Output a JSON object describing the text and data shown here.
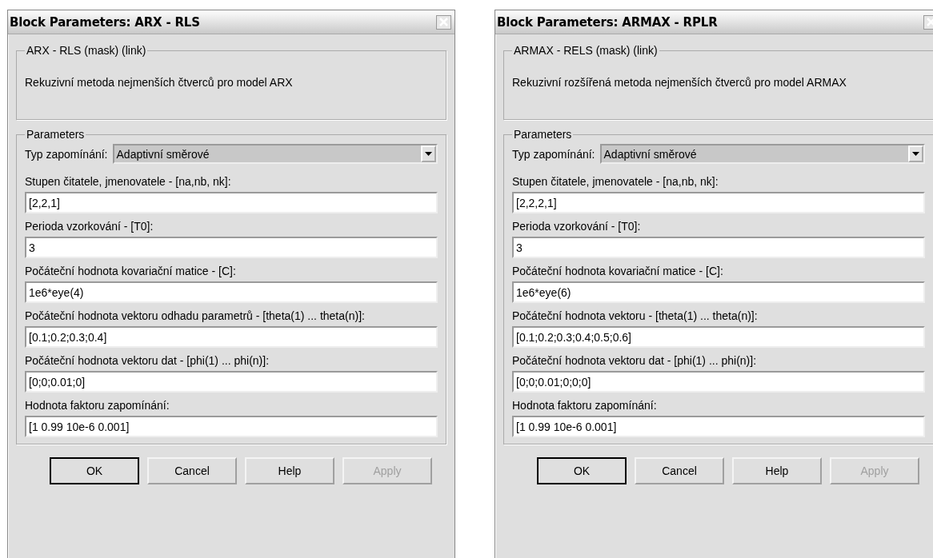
{
  "dialogs": [
    {
      "title": "Block Parameters: ARX - RLS",
      "mask_group": {
        "title": "ARX - RLS (mask) (link)",
        "description": "Rekuzivní metoda nejmenších čtverců pro model ARX"
      },
      "parameters_group": {
        "title": "Parameters",
        "combo": {
          "label": "Typ zapomínání:",
          "value": "Adaptivní směrové"
        },
        "fields": [
          {
            "label": "Stupen čitatele, jmenovatele - [na,nb, nk]:",
            "value": "[2,2,1]"
          },
          {
            "label": "Perioda vzorkování - [T0]:",
            "value": "3"
          },
          {
            "label": "Počáteční hodnota kovariační matice - [C]:",
            "value": "1e6*eye(4)"
          },
          {
            "label": "Počáteční hodnota vektoru odhadu parametrů - [theta(1) ... theta(n)]:",
            "value": "[0.1;0.2;0.3;0.4]"
          },
          {
            "label": "Počáteční hodnota vektoru dat - [phi(1) ... phi(n)]:",
            "value": "[0;0;0.01;0]"
          },
          {
            "label": "Hodnota faktoru zapomínání:",
            "value": "[1 0.99 10e-6 0.001]"
          }
        ]
      },
      "buttons": [
        {
          "label": "OK",
          "default": true,
          "disabled": false
        },
        {
          "label": "Cancel",
          "default": false,
          "disabled": false
        },
        {
          "label": "Help",
          "default": false,
          "disabled": false
        },
        {
          "label": "Apply",
          "default": false,
          "disabled": true
        }
      ]
    },
    {
      "title": "Block Parameters: ARMAX - RPLR",
      "mask_group": {
        "title": "ARMAX - RELS (mask) (link)",
        "description": "Rekuzivní rozšířená metoda nejmenších čtverců pro model ARMAX"
      },
      "parameters_group": {
        "title": "Parameters",
        "combo": {
          "label": "Typ zapomínání:",
          "value": "Adaptivní směrové"
        },
        "fields": [
          {
            "label": "Stupen čitatele, jmenovatele - [na,nb, nk]:",
            "value": "[2,2,2,1]"
          },
          {
            "label": "Perioda vzorkování - [T0]:",
            "value": "3"
          },
          {
            "label": "Počáteční hodnota kovariační matice - [C]:",
            "value": "1e6*eye(6)"
          },
          {
            "label": "Počáteční hodnota vektoru - [theta(1) ... theta(n)]:",
            "value": "[0.1;0.2;0.3;0.4;0.5;0.6]"
          },
          {
            "label": "Počáteční hodnota vektoru dat - [phi(1) ... phi(n)]:",
            "value": "[0;0;0.01;0;0;0]"
          },
          {
            "label": "Hodnota faktoru zapomínání:",
            "value": "[1 0.99 10e-6 0.001]"
          }
        ]
      },
      "buttons": [
        {
          "label": "OK",
          "default": true,
          "disabled": false
        },
        {
          "label": "Cancel",
          "default": false,
          "disabled": false
        },
        {
          "label": "Help",
          "default": false,
          "disabled": false
        },
        {
          "label": "Apply",
          "default": false,
          "disabled": true
        }
      ]
    }
  ]
}
